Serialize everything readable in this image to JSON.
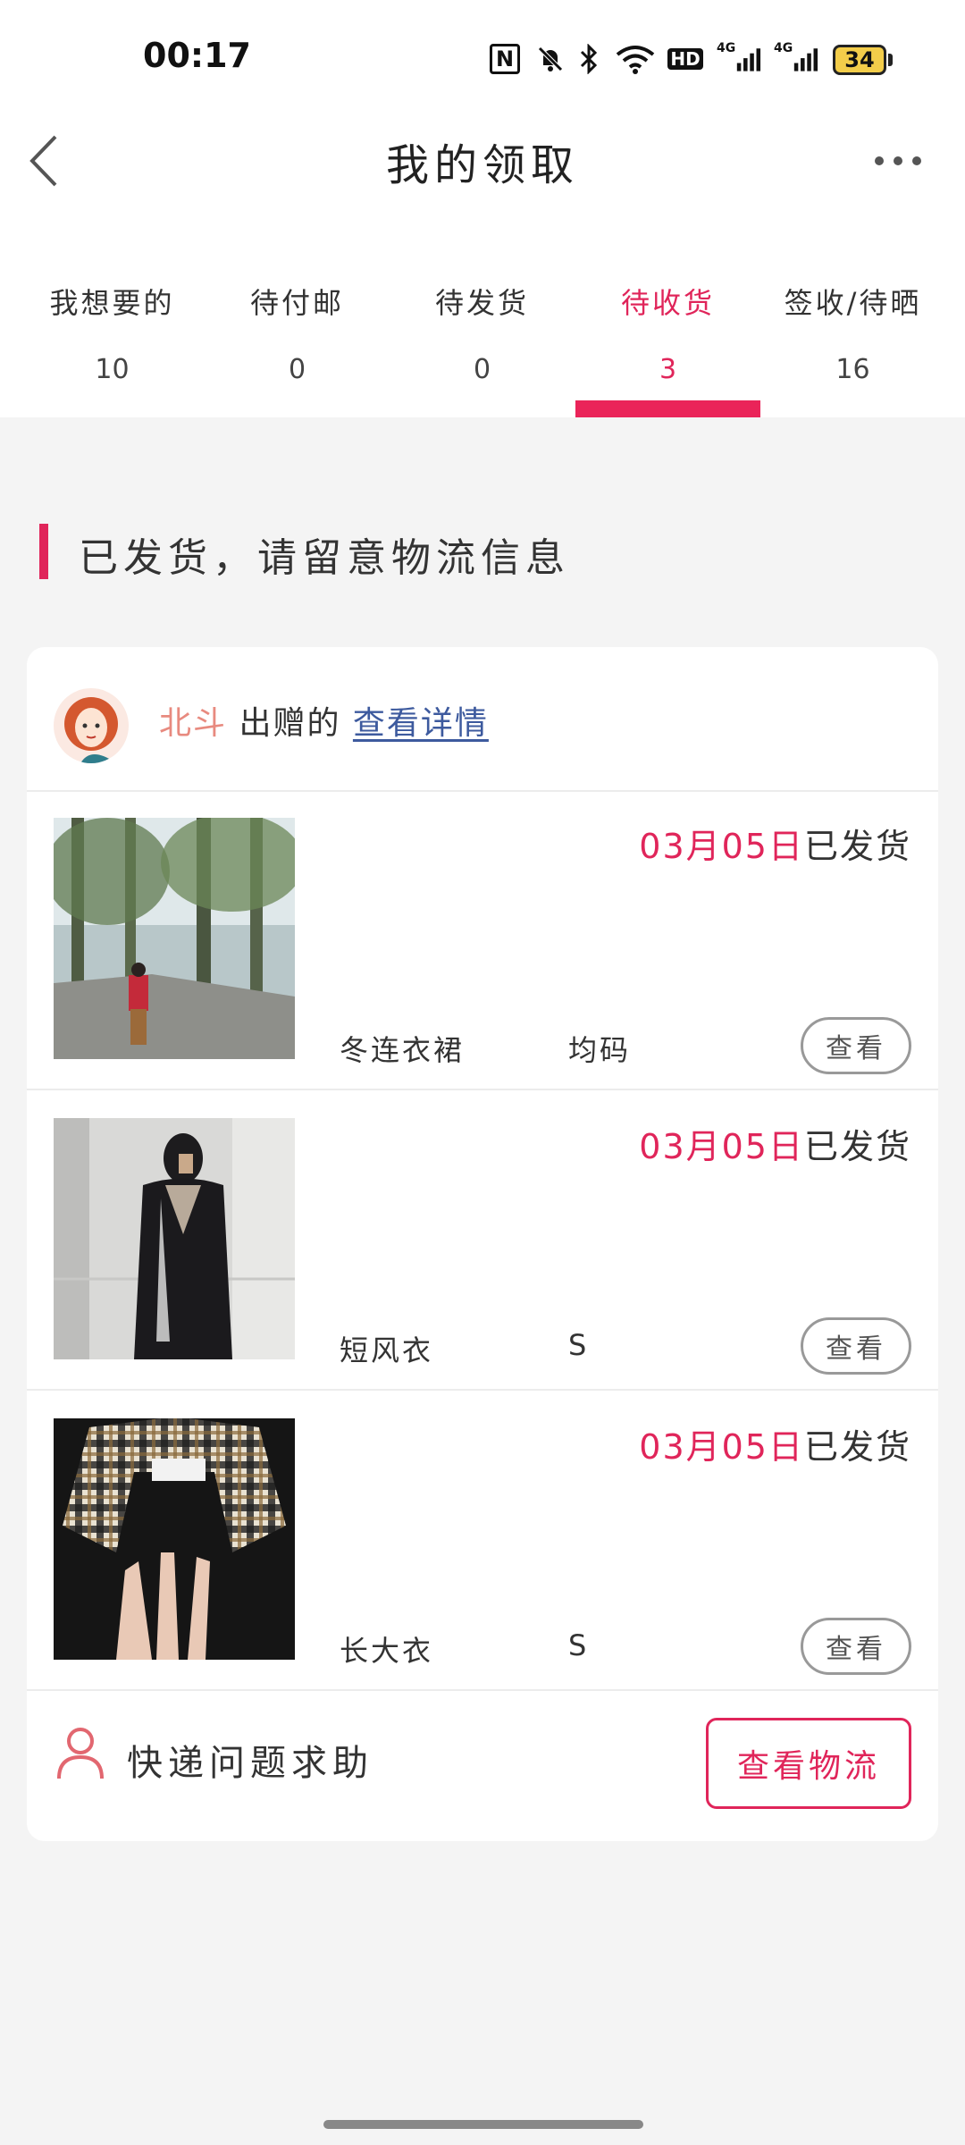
{
  "status_bar": {
    "time": "00:17",
    "icons": [
      "nfc-icon",
      "mute-icon",
      "bluetooth-icon",
      "wifi-icon",
      "hd-icon",
      "signal-4g-icon",
      "signal-4g-icon"
    ],
    "nfc": "N",
    "hd": "HD",
    "signal_1": "4G",
    "signal_2": "4G",
    "battery": "34"
  },
  "header": {
    "title": "我的领取",
    "back_icon": "chevron-left-icon",
    "more_icon": "more-horizontal-icon"
  },
  "tabs": [
    {
      "label": "我想要的",
      "count": "10",
      "active": false
    },
    {
      "label": "待付邮",
      "count": "0",
      "active": false
    },
    {
      "label": "待发货",
      "count": "0",
      "active": false
    },
    {
      "label": "待收货",
      "count": "3",
      "active": true
    },
    {
      "label": "签收/待晒",
      "count": "16",
      "active": false
    }
  ],
  "notice": "已发货，请留意物流信息",
  "giver": {
    "name": "北斗",
    "suffix": " 出赠的 ",
    "detail_link": "查看详情"
  },
  "items": [
    {
      "date": "03月05日",
      "status": "已发货",
      "name": "冬连衣裙",
      "size": "均码",
      "button": "查看"
    },
    {
      "date": "03月05日",
      "status": "已发货",
      "name": "短风衣",
      "size": "S",
      "button": "查看"
    },
    {
      "date": "03月05日",
      "status": "已发货",
      "name": "长大衣",
      "size": "S",
      "button": "查看"
    }
  ],
  "footer": {
    "help_text": "快递问题求助",
    "logistics_button": "查看物流"
  },
  "colors": {
    "accent": "#e0255a",
    "giver_name": "#e88a7f",
    "link": "#3d5a9e",
    "background": "#f4f4f4"
  }
}
